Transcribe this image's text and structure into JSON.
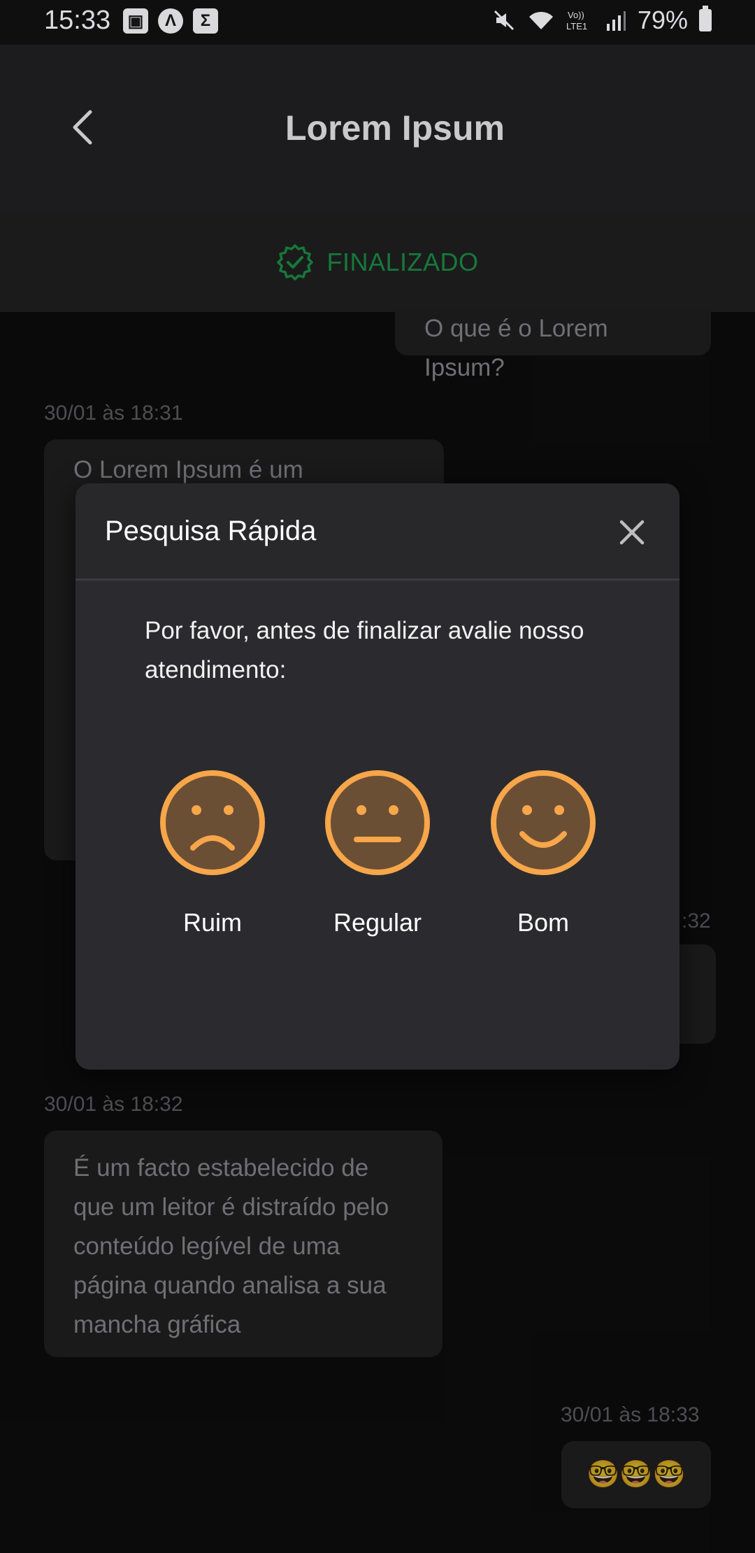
{
  "status_bar": {
    "time": "15:33",
    "left_icons": [
      "image-icon",
      "lambda-icon",
      "sigma-icon"
    ],
    "right_icons": [
      "mute-icon",
      "wifi-icon",
      "volte-lte-icon",
      "signal-icon",
      "battery-icon"
    ],
    "battery": "79%"
  },
  "header": {
    "title": "Lorem Ipsum",
    "back_icon": "chevron-left-icon",
    "status": {
      "label": "FINALIZADO",
      "icon": "verified-badge-icon",
      "color": "#1fa851"
    }
  },
  "messages": [
    {
      "side": "right",
      "timestamp": "",
      "text": "O que é o Lorem Ipsum?"
    },
    {
      "side": "left",
      "timestamp": "30/01 às 18:31",
      "text": "O Lorem Ipsum é um"
    },
    {
      "side": "right",
      "timestamp": ":32",
      "text": ""
    },
    {
      "side": "left",
      "timestamp": "30/01 às 18:32",
      "text": "É um facto estabelecido de que um leitor é distraído pelo conteúdo legível de uma página quando analisa a sua mancha gráfica"
    },
    {
      "side": "right",
      "timestamp": "30/01 às 18:33",
      "text": "🤓🤓🤓"
    }
  ],
  "survey": {
    "title": "Pesquisa Rápida",
    "close_icon": "close-icon",
    "question": "Por favor, antes de finalizar avalie nosso atendimento:",
    "accent_color": "#f7a64a",
    "options": [
      {
        "label": "Ruim",
        "icon": "sad-face-icon"
      },
      {
        "label": "Regular",
        "icon": "neutral-face-icon"
      },
      {
        "label": "Bom",
        "icon": "happy-face-icon"
      }
    ]
  }
}
